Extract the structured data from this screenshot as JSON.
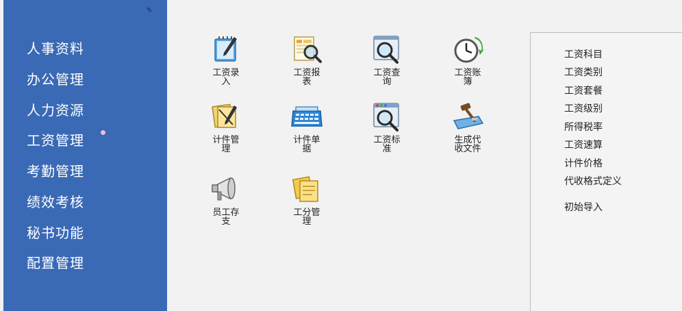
{
  "sidebar": {
    "items": [
      {
        "label": "人事资料"
      },
      {
        "label": "办公管理"
      },
      {
        "label": "人力资源"
      },
      {
        "label": "工资管理"
      },
      {
        "label": "考勤管理"
      },
      {
        "label": "绩效考核"
      },
      {
        "label": "秘书功能"
      },
      {
        "label": "配置管理"
      }
    ]
  },
  "modules": [
    {
      "label": "工资录入",
      "icon": "pen-notepad-icon"
    },
    {
      "label": "工资报表",
      "icon": "report-magnifier-icon"
    },
    {
      "label": "工资查询",
      "icon": "search-magnifier-icon"
    },
    {
      "label": "工资账簿",
      "icon": "clock-arrow-icon"
    },
    {
      "label": "计件管理",
      "icon": "documents-pen-icon"
    },
    {
      "label": "计件单据",
      "icon": "calculator-icon"
    },
    {
      "label": "工资标准",
      "icon": "window-magnifier-icon"
    },
    {
      "label": "生成代收文件",
      "icon": "gavel-icon"
    },
    {
      "label": "员工存支",
      "icon": "megaphone-icon"
    },
    {
      "label": "工分管理",
      "icon": "notes-stack-icon"
    }
  ],
  "right_panel": {
    "items": [
      {
        "label": "工资科目"
      },
      {
        "label": "工资类别"
      },
      {
        "label": "工资套餐"
      },
      {
        "label": "工资级别"
      },
      {
        "label": "所得税率"
      },
      {
        "label": "工资速算"
      },
      {
        "label": "计件价格"
      },
      {
        "label": "代收格式定义"
      },
      {
        "label": "初始导入"
      }
    ]
  },
  "colors": {
    "sidebar_bg": "#3a6ab6",
    "main_bg": "#f2f2f2",
    "right_panel_bg": "#f4f4f4"
  }
}
